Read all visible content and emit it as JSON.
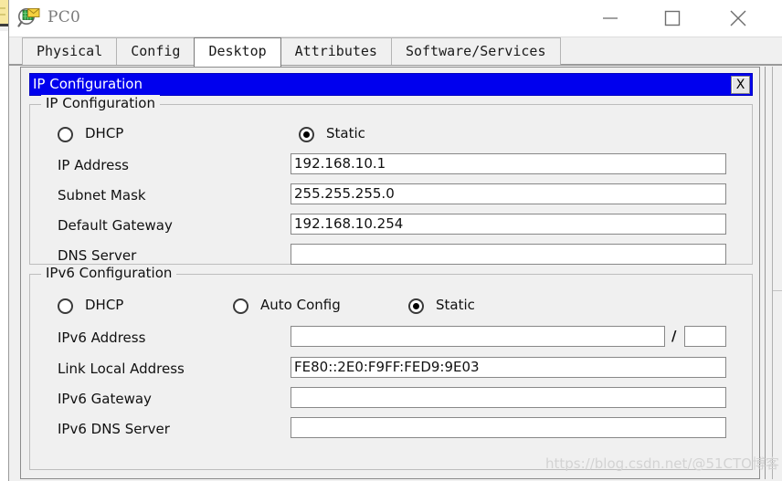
{
  "window": {
    "title": "PC0",
    "icon": "packet-tracer-pc-icon",
    "controls": {
      "minimize": "minimize-icon",
      "maximize": "maximize-icon",
      "close": "close-icon"
    }
  },
  "tabs": [
    {
      "label": "Physical",
      "active": false
    },
    {
      "label": "Config",
      "active": false
    },
    {
      "label": "Desktop",
      "active": true
    },
    {
      "label": "Attributes",
      "active": false
    },
    {
      "label": "Software/Services",
      "active": false
    }
  ],
  "dialog": {
    "title": "IP Configuration",
    "close_label": "X",
    "close_icon": "close-x-icon"
  },
  "ipv4": {
    "legend": "IP Configuration",
    "mode_options": [
      {
        "label": "DHCP",
        "selected": false
      },
      {
        "label": "Static",
        "selected": true
      }
    ],
    "fields": [
      {
        "label": "IP Address",
        "value": "192.168.10.1"
      },
      {
        "label": "Subnet Mask",
        "value": "255.255.255.0"
      },
      {
        "label": "Default Gateway",
        "value": "192.168.10.254"
      },
      {
        "label": "DNS Server",
        "value": ""
      }
    ]
  },
  "ipv6": {
    "legend": "IPv6 Configuration",
    "mode_options": [
      {
        "label": "DHCP",
        "selected": false
      },
      {
        "label": "Auto Config",
        "selected": false
      },
      {
        "label": "Static",
        "selected": true
      }
    ],
    "prefix_separator": "/",
    "fields": [
      {
        "label": "IPv6 Address",
        "value": "",
        "prefix": ""
      },
      {
        "label": "Link Local Address",
        "value": "FE80::2E0:F9FF:FED9:9E03"
      },
      {
        "label": "IPv6 Gateway",
        "value": ""
      },
      {
        "label": "IPv6 DNS Server",
        "value": ""
      }
    ]
  },
  "watermark": {
    "text": "https://blog.csdn.net/@51CTO博客"
  },
  "colors": {
    "dialog_title_bg": "#0000ee",
    "dialog_title_fg": "#ffffff",
    "window_bg": "#f0f0f0",
    "field_bg": "#ffffff",
    "border": "#888888"
  }
}
